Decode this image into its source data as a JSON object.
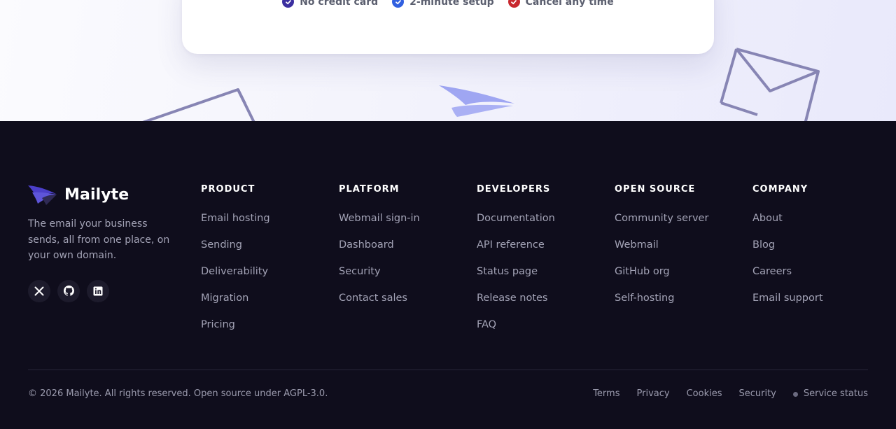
{
  "hero": {
    "perks": [
      {
        "label": "No credit card",
        "color": "#3b2fa0"
      },
      {
        "label": "2-minute setup",
        "color": "#3160e0"
      },
      {
        "label": "Cancel any time",
        "color": "#c8282e"
      }
    ]
  },
  "brand": {
    "name": "Mailyte",
    "tagline": "The email your business sends, all from one place, on your own domain.",
    "socials": [
      {
        "icon": "x-icon"
      },
      {
        "icon": "github-icon"
      },
      {
        "icon": "linkedin-icon"
      }
    ]
  },
  "columns": [
    {
      "title": "PRODUCT",
      "links": [
        "Email hosting",
        "Sending",
        "Deliverability",
        "Migration",
        "Pricing"
      ]
    },
    {
      "title": "PLATFORM",
      "links": [
        "Webmail sign-in",
        "Dashboard",
        "Security",
        "Contact sales"
      ]
    },
    {
      "title": "DEVELOPERS",
      "links": [
        "Documentation",
        "API reference",
        "Status page",
        "Release notes",
        "FAQ"
      ]
    },
    {
      "title": "OPEN SOURCE",
      "links": [
        "Community server",
        "Webmail",
        "GitHub org",
        "Self-hosting"
      ]
    },
    {
      "title": "COMPANY",
      "links": [
        "About",
        "Blog",
        "Careers",
        "Email support"
      ]
    }
  ],
  "bottom": {
    "copyright": "© 2026 Mailyte. All rights reserved. Open source under AGPL-3.0.",
    "legal": [
      "Terms",
      "Privacy",
      "Cookies",
      "Security"
    ],
    "status": "Service status"
  },
  "colors": {
    "footer_bg": "#0f0d1c",
    "accent": "#5a4fd6"
  }
}
